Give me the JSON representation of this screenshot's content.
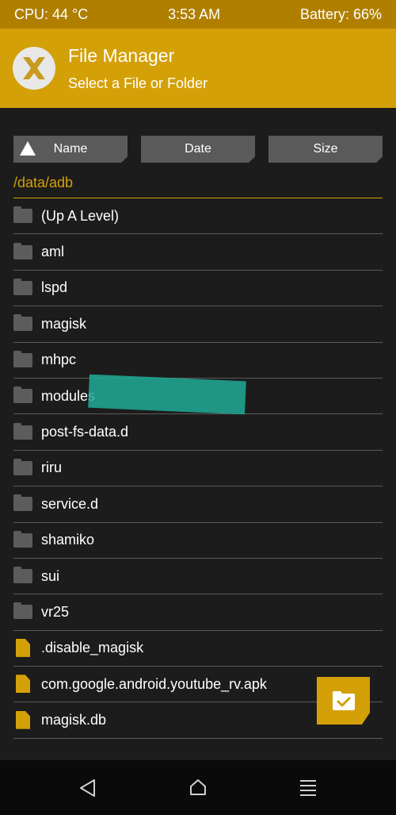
{
  "status_bar": {
    "cpu": "CPU: 44 °C",
    "time": "3:53 AM",
    "battery": "Battery: 66%"
  },
  "header": {
    "title": "File Manager",
    "subtitle": "Select a File or Folder",
    "logo_icon": "twrp-logo-icon"
  },
  "sort": {
    "name_label": "Name",
    "date_label": "Date",
    "size_label": "Size"
  },
  "path": "/data/adb",
  "files": [
    {
      "name": "(Up A Level)",
      "type": "folder"
    },
    {
      "name": "aml",
      "type": "folder"
    },
    {
      "name": "lspd",
      "type": "folder"
    },
    {
      "name": "magisk",
      "type": "folder"
    },
    {
      "name": "mhpc",
      "type": "folder"
    },
    {
      "name": "modules",
      "type": "folder"
    },
    {
      "name": "post-fs-data.d",
      "type": "folder"
    },
    {
      "name": "riru",
      "type": "folder"
    },
    {
      "name": "service.d",
      "type": "folder"
    },
    {
      "name": "shamiko",
      "type": "folder"
    },
    {
      "name": "sui",
      "type": "folder"
    },
    {
      "name": "vr25",
      "type": "folder"
    },
    {
      "name": ".disable_magisk",
      "type": "file"
    },
    {
      "name": "com.google.android.youtube_rv.apk",
      "type": "file"
    },
    {
      "name": "magisk.db",
      "type": "file"
    }
  ],
  "colors": {
    "accent": "#d4a008",
    "status_bar": "#b07f00",
    "background": "#1c1c1c",
    "button": "#5a5a5a"
  },
  "fab_icon": "folder-check-icon",
  "nav": {
    "back_icon": "back-icon",
    "home_icon": "home-icon",
    "menu_icon": "menu-icon"
  }
}
